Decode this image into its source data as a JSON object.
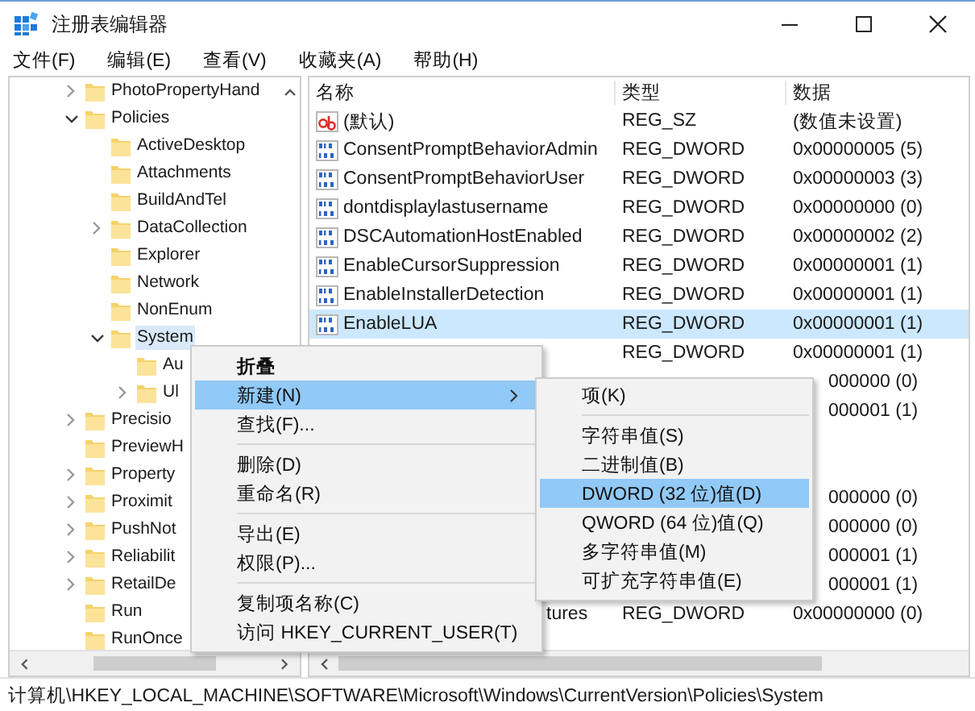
{
  "window": {
    "title": "注册表编辑器"
  },
  "menu_bar": [
    "文件(F)",
    "编辑(E)",
    "查看(V)",
    "收藏夹(A)",
    "帮助(H)"
  ],
  "tree": [
    {
      "label": "PhotoPropertyHand",
      "expanded": false,
      "selected": false
    },
    {
      "label": "Policies",
      "expanded": true,
      "selected": false,
      "children": [
        {
          "label": "ActiveDesktop",
          "selected": false
        },
        {
          "label": "Attachments",
          "selected": false
        },
        {
          "label": "BuildAndTel",
          "selected": false
        },
        {
          "label": "DataCollection",
          "expanded": false,
          "selected": false
        },
        {
          "label": "Explorer",
          "selected": false
        },
        {
          "label": "Network",
          "selected": false
        },
        {
          "label": "NonEnum",
          "selected": false
        },
        {
          "label": "System",
          "expanded": true,
          "selected": true,
          "children": [
            {
              "label": "Au",
              "selected": false
            },
            {
              "label": "Ul",
              "expanded": false,
              "selected": false
            }
          ]
        }
      ]
    },
    {
      "label": "Precisio",
      "expanded": false,
      "selected": false
    },
    {
      "label": "PreviewH",
      "selected": false
    },
    {
      "label": "Property",
      "expanded": false,
      "selected": false
    },
    {
      "label": "Proximit",
      "expanded": false,
      "selected": false
    },
    {
      "label": "PushNot",
      "expanded": false,
      "selected": false
    },
    {
      "label": "Reliabilit",
      "expanded": false,
      "selected": false
    },
    {
      "label": "RetailDe",
      "expanded": false,
      "selected": false
    },
    {
      "label": "Run",
      "selected": false
    },
    {
      "label": "RunOnce",
      "selected": false
    }
  ],
  "table": {
    "columns": [
      "名称",
      "类型",
      "数据"
    ],
    "rows": [
      {
        "kind": "string",
        "name": "(默认)",
        "type": "REG_SZ",
        "data": "(数值未设置)",
        "selected": false
      },
      {
        "kind": "dword",
        "name": "ConsentPromptBehaviorAdmin",
        "type": "REG_DWORD",
        "data": "0x00000005 (5)",
        "selected": false
      },
      {
        "kind": "dword",
        "name": "ConsentPromptBehaviorUser",
        "type": "REG_DWORD",
        "data": "0x00000003 (3)",
        "selected": false
      },
      {
        "kind": "dword",
        "name": "dontdisplaylastusername",
        "type": "REG_DWORD",
        "data": "0x00000000 (0)",
        "selected": false
      },
      {
        "kind": "dword",
        "name": "DSCAutomationHostEnabled",
        "type": "REG_DWORD",
        "data": "0x00000002 (2)",
        "selected": false
      },
      {
        "kind": "dword",
        "name": "EnableCursorSuppression",
        "type": "REG_DWORD",
        "data": "0x00000001 (1)",
        "selected": false
      },
      {
        "kind": "dword",
        "name": "EnableInstallerDetection",
        "type": "REG_DWORD",
        "data": "0x00000001 (1)",
        "selected": false
      },
      {
        "kind": "dword",
        "name": "EnableLUA",
        "type": "REG_DWORD",
        "data": "0x00000001 (1)",
        "selected": true
      },
      {
        "type": "REG_DWORD",
        "data": "0x00000001 (1)",
        "selected": false
      },
      {
        "data": "000000 (0)",
        "selected": false
      },
      {
        "data": "000001 (1)",
        "selected": false
      },
      {
        "selected": false
      },
      {
        "selected": false
      },
      {
        "data": "000000 (0)",
        "selected": false
      },
      {
        "data": "000000 (0)",
        "selected": false
      },
      {
        "data": "000001 (1)",
        "selected": false
      },
      {
        "data": "000001 (1)",
        "selected": false
      },
      {
        "name": "tures",
        "type": "REG_DWORD",
        "data": "0x00000000 (0)",
        "selected": false
      }
    ]
  },
  "context_menu": [
    {
      "kind": "item",
      "label": "折叠",
      "default": true,
      "submenu": false,
      "highlighted": false
    },
    {
      "kind": "item",
      "label": "新建(N)",
      "default": false,
      "submenu": true,
      "highlighted": true
    },
    {
      "kind": "item",
      "label": "查找(F)...",
      "default": false,
      "submenu": false,
      "highlighted": false
    },
    {
      "kind": "separator"
    },
    {
      "kind": "item",
      "label": "删除(D)",
      "default": false,
      "submenu": false,
      "highlighted": false
    },
    {
      "kind": "item",
      "label": "重命名(R)",
      "default": false,
      "submenu": false,
      "highlighted": false
    },
    {
      "kind": "separator"
    },
    {
      "kind": "item",
      "label": "导出(E)",
      "default": false,
      "submenu": false,
      "highlighted": false
    },
    {
      "kind": "item",
      "label": "权限(P)...",
      "default": false,
      "submenu": false,
      "highlighted": false
    },
    {
      "kind": "separator"
    },
    {
      "kind": "item",
      "label": "复制项名称(C)",
      "default": false,
      "submenu": false,
      "highlighted": false
    },
    {
      "kind": "item",
      "label": "访问 HKEY_CURRENT_USER(T)",
      "default": false,
      "submenu": false,
      "highlighted": false
    }
  ],
  "submenu": [
    {
      "kind": "item",
      "label": "项(K)",
      "highlighted": false
    },
    {
      "kind": "separator"
    },
    {
      "kind": "item",
      "label": "字符串值(S)",
      "highlighted": false
    },
    {
      "kind": "item",
      "label": "二进制值(B)",
      "highlighted": false
    },
    {
      "kind": "item",
      "label": "DWORD (32 位)值(D)",
      "highlighted": true
    },
    {
      "kind": "item",
      "label": "QWORD (64 位)值(Q)",
      "highlighted": false
    },
    {
      "kind": "item",
      "label": "多字符串值(M)",
      "highlighted": false
    },
    {
      "kind": "item",
      "label": "可扩充字符串值(E)",
      "highlighted": false
    }
  ],
  "status_bar": "计算机\\HKEY_LOCAL_MACHINE\\SOFTWARE\\Microsoft\\Windows\\CurrentVersion\\Policies\\System"
}
